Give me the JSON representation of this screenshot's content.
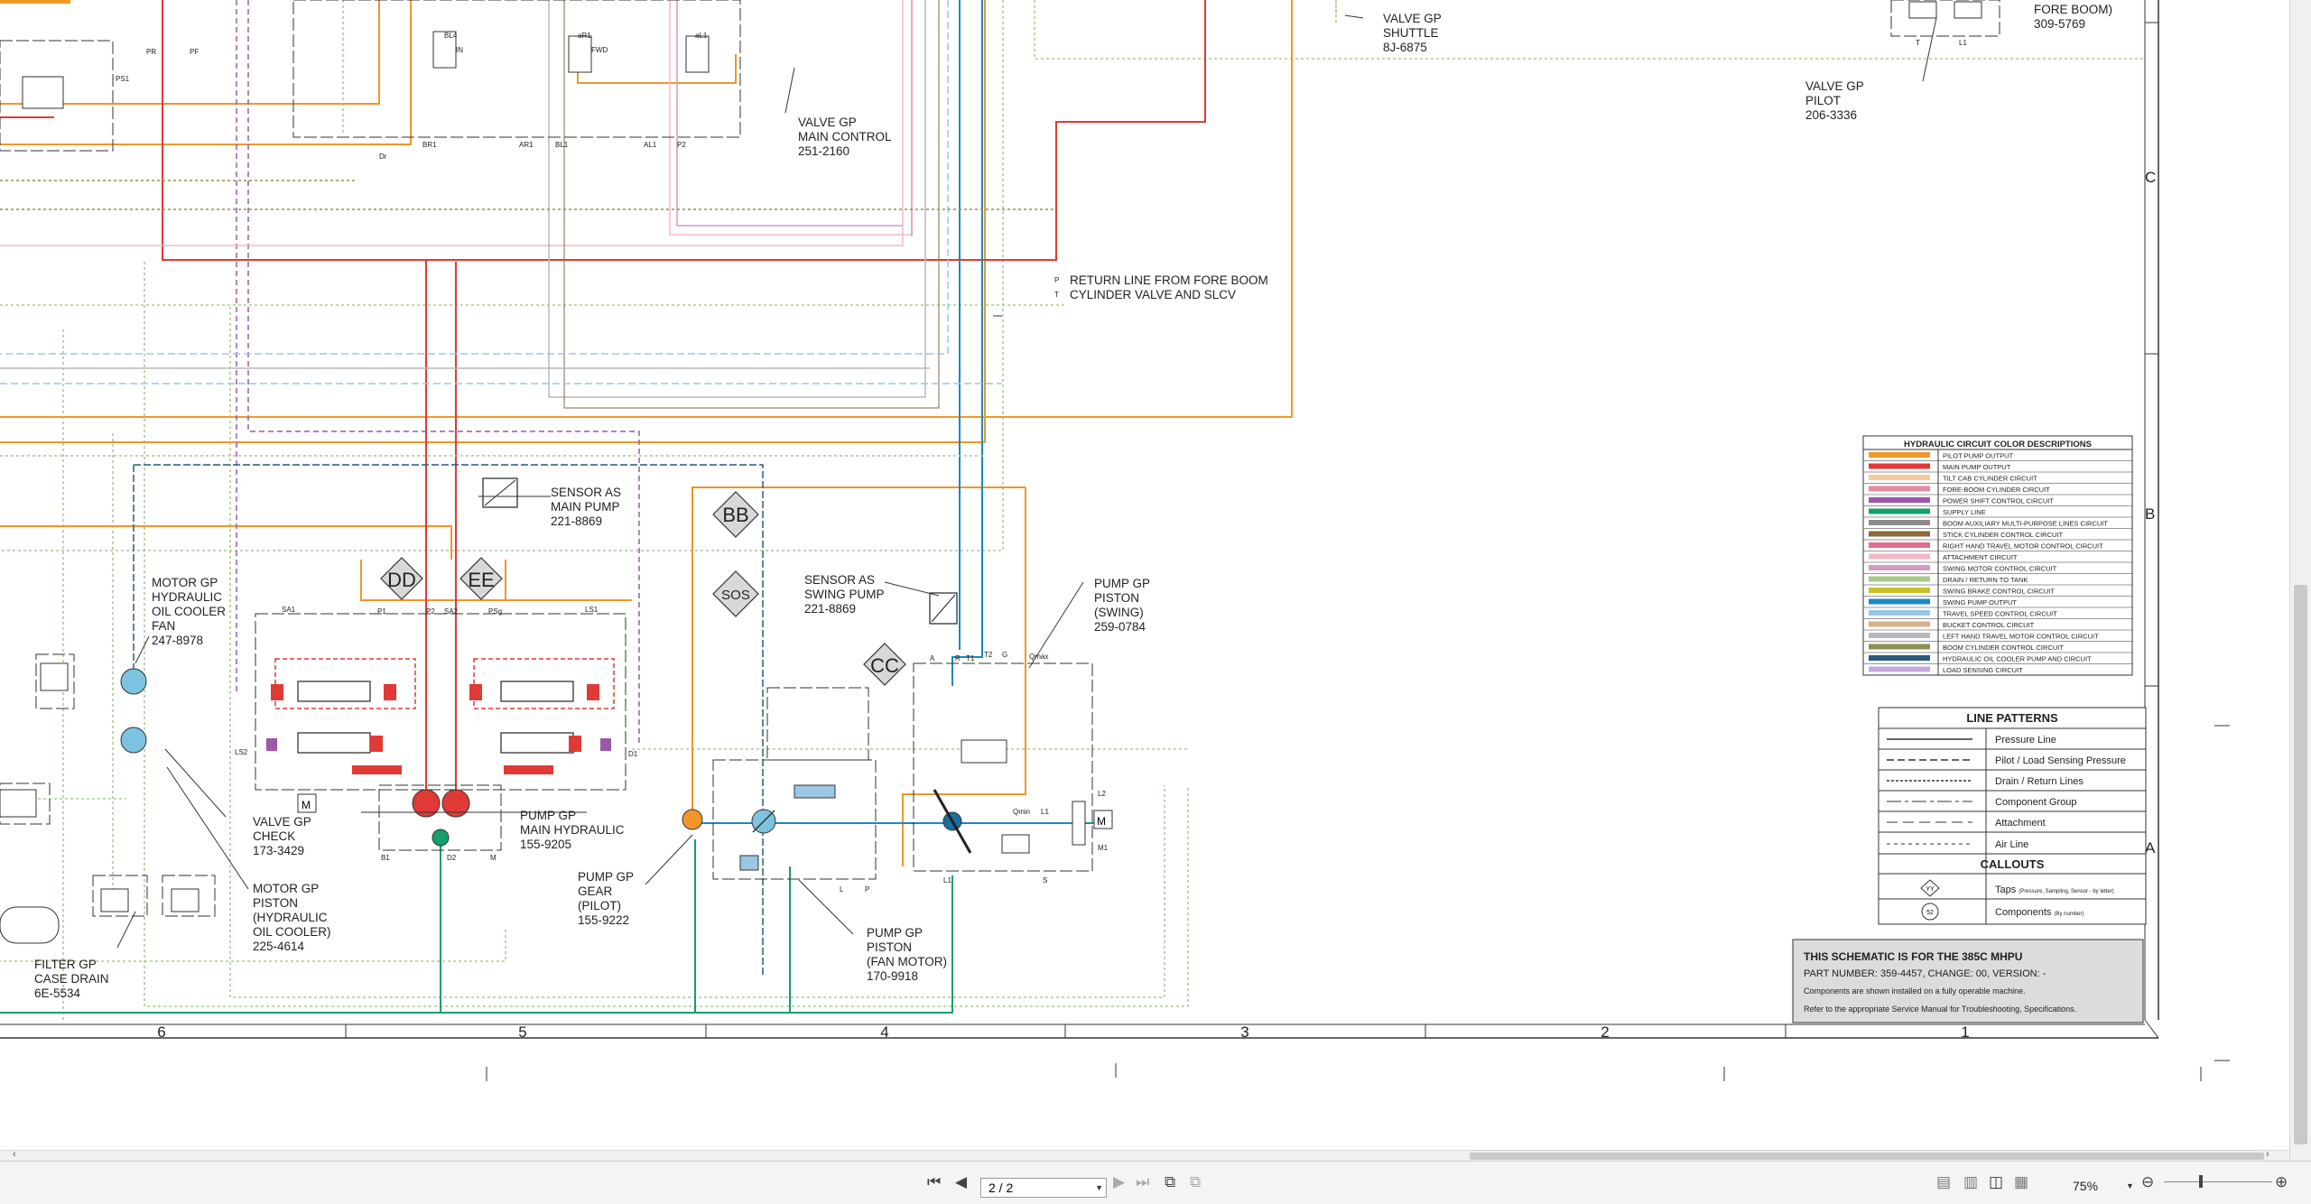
{
  "schematic": {
    "callouts": [
      {
        "id": "valve-shuttle",
        "lines": [
          "VALVE GP",
          "SHUTTLE",
          "8J-6875"
        ]
      },
      {
        "id": "valve-main-control",
        "lines": [
          "VALVE GP",
          "MAIN CONTROL",
          "251-2160"
        ]
      },
      {
        "id": "fore-boom",
        "lines": [
          "FORE BOOM)",
          "309-5769"
        ]
      },
      {
        "id": "valve-pilot",
        "lines": [
          "VALVE GP",
          "PILOT",
          "206-3336"
        ]
      },
      {
        "id": "return-line",
        "lines": [
          "RETURN LINE FROM FORE BOOM",
          "CYLINDER VALVE AND SLCV"
        ]
      },
      {
        "id": "sensor-main-pump",
        "lines": [
          "SENSOR AS",
          "MAIN PUMP",
          "221-8869"
        ]
      },
      {
        "id": "sensor-swing-pump",
        "lines": [
          "SENSOR AS",
          "SWING PUMP",
          "221-8869"
        ]
      },
      {
        "id": "pump-piston-swing",
        "lines": [
          "PUMP GP",
          "PISTON",
          "(SWING)",
          "259-0784"
        ]
      },
      {
        "id": "motor-oil-cooler-fan",
        "lines": [
          "MOTOR GP",
          "HYDRAULIC",
          "OIL COOLER",
          "FAN",
          "247-8978"
        ]
      },
      {
        "id": "valve-check",
        "lines": [
          "VALVE GP",
          "CHECK",
          "173-3429"
        ]
      },
      {
        "id": "pump-main-hydraulic",
        "lines": [
          "PUMP GP",
          "MAIN HYDRAULIC",
          "155-9205"
        ]
      },
      {
        "id": "motor-piston-cooler",
        "lines": [
          "MOTOR GP",
          "PISTON",
          "(HYDRAULIC",
          "OIL COOLER)",
          "225-4614"
        ]
      },
      {
        "id": "pump-gear-pilot",
        "lines": [
          "PUMP GP",
          "GEAR",
          "(PILOT)",
          "155-9222"
        ]
      },
      {
        "id": "pump-piston-fan",
        "lines": [
          "PUMP GP",
          "PISTON",
          "(FAN MOTOR)",
          "170-9918"
        ]
      },
      {
        "id": "filter-case-drain",
        "lines": [
          "FILTER GP",
          "CASE DRAIN",
          "6E-5534"
        ]
      }
    ],
    "tap_labels": [
      "DD",
      "EE",
      "BB",
      "SOS",
      "CC"
    ],
    "port_labels": [
      "PR",
      "PF",
      "BL4",
      "IN",
      "aR1",
      "FWD",
      "aL1",
      "BR1",
      "AR1",
      "BL1",
      "AL1",
      "P2",
      "Dr",
      "PS1",
      "SA1",
      "P1",
      "P2",
      "SA2",
      "PSg",
      "LS1",
      "LS2",
      "D1",
      "B1",
      "D2",
      "M",
      "A",
      "R",
      "T1",
      "T2",
      "G",
      "Qmax",
      "Qmin",
      "L1",
      "L2",
      "M1",
      "S",
      "L1",
      "L",
      "P",
      "T",
      "L1",
      "L2"
    ],
    "row_labels": [
      "C",
      "B",
      "A"
    ],
    "column_numbers": [
      "6",
      "5",
      "4",
      "3",
      "2",
      "1"
    ],
    "color_legend": {
      "title": "HYDRAULIC CIRCUIT COLOR DESCRIPTIONS",
      "items": [
        {
          "label": "PILOT PUMP OUTPUT",
          "color": "#f0962a"
        },
        {
          "label": "MAIN PUMP OUTPUT",
          "color": "#e03a36"
        },
        {
          "label": "TILT CAB CYLINDER CIRCUIT",
          "color": "#f6c9a0"
        },
        {
          "label": "FORE-BOOM CYLINDER CIRCUIT",
          "color": "#e58aa0"
        },
        {
          "label": "POWER SHIFT CONTROL CIRCUIT",
          "color": "#9b58a8"
        },
        {
          "label": "SUPPLY LINE",
          "color": "#13a06a"
        },
        {
          "label": "BOOM AUXILIARY MULTI-PURPOSE LINES CIRCUIT",
          "color": "#8b8b8b"
        },
        {
          "label": "STICK CYLINDER CONTROL CIRCUIT",
          "color": "#8a6a3a"
        },
        {
          "label": "RIGHT HAND TRAVEL MOTOR CONTROL CIRCUIT",
          "color": "#e06f8e"
        },
        {
          "label": "ATTACHMENT CIRCUIT",
          "color": "#f2b8c6"
        },
        {
          "label": "SWING MOTOR CONTROL CIRCUIT",
          "color": "#d49ac7"
        },
        {
          "label": "DRAIN / RETURN TO TANK",
          "color": "#a9c98a"
        },
        {
          "label": "SWING BRAKE CONTROL CIRCUIT",
          "color": "#c8c22a"
        },
        {
          "label": "SWING PUMP OUTPUT",
          "color": "#1a8ac0"
        },
        {
          "label": "TRAVEL SPEED CONTROL CIRCUIT",
          "color": "#9ac7e3"
        },
        {
          "label": "BUCKET CONTROL CIRCUIT",
          "color": "#d6b08a"
        },
        {
          "label": "LEFT HAND TRAVEL MOTOR CONTROL CIRCUIT",
          "color": "#b9b9b9"
        },
        {
          "label": "BOOM CYLINDER CONTROL CIRCUIT",
          "color": "#8f8f55"
        },
        {
          "label": "HYDRAULIC OIL COOLER PUMP AND CIRCUIT",
          "color": "#2a5a7a"
        },
        {
          "label": "LOAD SENSING CIRCUIT",
          "color": "#c9a9dd"
        }
      ]
    },
    "line_patterns": {
      "title": "LINE PATTERNS",
      "items": [
        "Pressure Line",
        "Pilot / Load Sensing Pressure",
        "Drain / Return Lines",
        "Component Group",
        "Attachment",
        "Air Line"
      ]
    },
    "callouts_key": {
      "title": "CALLOUTS",
      "taps_label": "Taps",
      "taps_note": "(Pressure, Sampling, Sensor - by letter)",
      "components_label": "Components",
      "components_note": "(By number)",
      "tap_symbol": "YY",
      "component_symbol": "52"
    },
    "title_block": {
      "line1": "THIS SCHEMATIC IS FOR THE 385C MHPU",
      "line2": "PART NUMBER: 359-4457, CHANGE: 00, VERSION: -",
      "line3": "Components are shown installed on a fully operable machine.",
      "line4": "Refer to the appropriate Service Manual for Troubleshooting, Specifications."
    }
  },
  "toolbar": {
    "page_value": "2 / 2",
    "zoom": "75%"
  }
}
